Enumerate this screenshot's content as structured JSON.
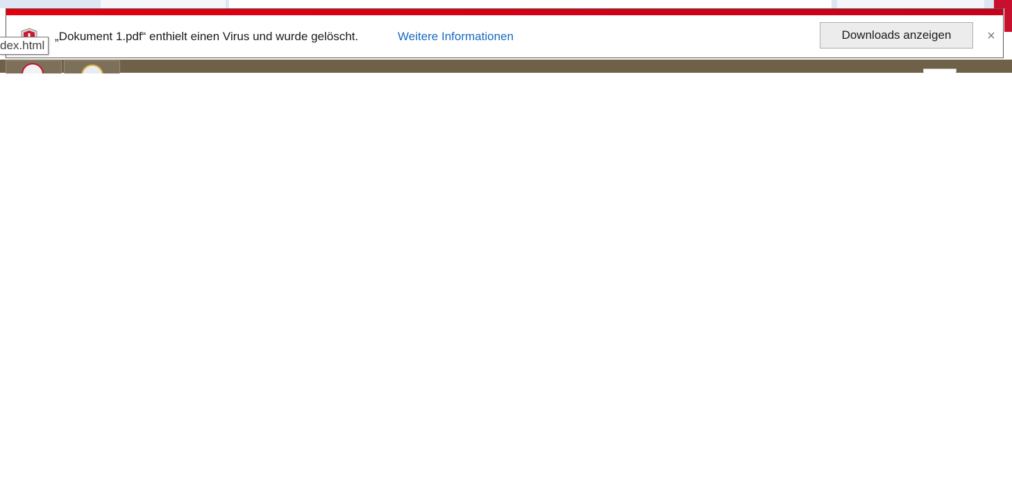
{
  "notification": {
    "message": "„Dokument 1.pdf“ enthielt einen Virus und wurde gelöscht.",
    "more_info_label": "Weitere Informationen",
    "downloads_button_label": "Downloads anzeigen",
    "close_symbol": "×",
    "icon": "shield-warning-icon",
    "accent_color": "#e3000f",
    "link_color": "#1769c0"
  },
  "tooltip": {
    "text": "dex.html"
  },
  "taskbar": {
    "background_color": "#6e6148",
    "pinned_icons": [
      "browser-icon",
      "media-player-icon"
    ]
  }
}
